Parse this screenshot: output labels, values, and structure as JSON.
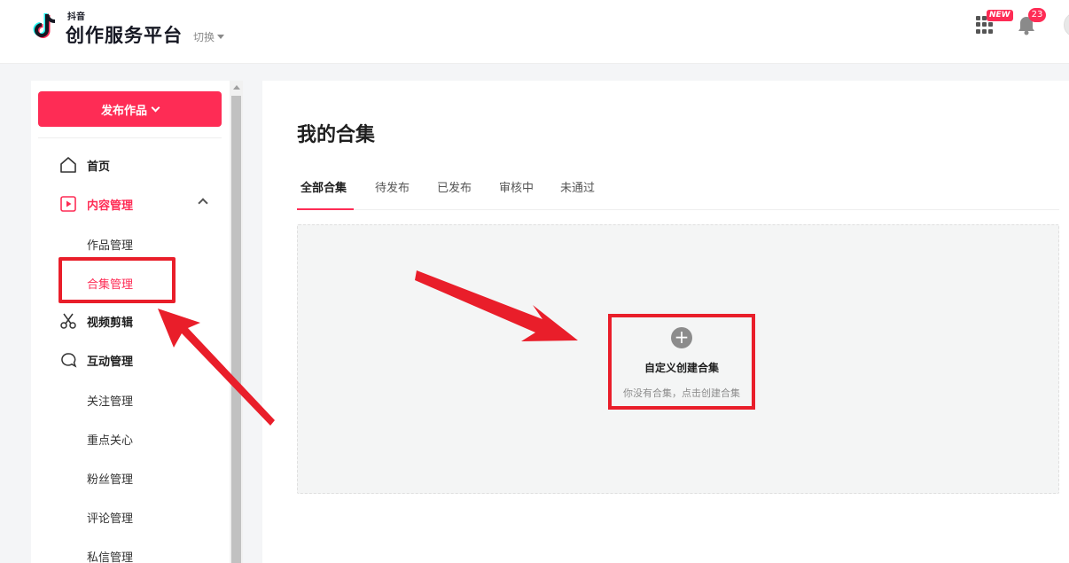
{
  "header": {
    "brand_small": "抖音",
    "brand_title": "创作服务平台",
    "switch_label": "切换",
    "new_badge": "NEW",
    "notification_count": "23"
  },
  "sidebar": {
    "publish_label": "发布作品",
    "items": [
      {
        "label": "首页",
        "icon": "home-icon"
      },
      {
        "label": "内容管理",
        "icon": "play-square-icon",
        "active": true
      },
      {
        "label": "视频剪辑",
        "icon": "scissors-icon"
      },
      {
        "label": "互动管理",
        "icon": "chat-bubble-icon"
      }
    ],
    "content_sub": [
      "作品管理",
      "合集管理"
    ],
    "interaction_sub": [
      "关注管理",
      "重点关心",
      "粉丝管理",
      "评论管理",
      "私信管理"
    ]
  },
  "main": {
    "title": "我的合集",
    "tabs": [
      "全部合集",
      "待发布",
      "已发布",
      "审核中",
      "未通过"
    ],
    "active_tab": "全部合集",
    "create": {
      "title": "自定义创建合集",
      "subtitle": "你没有合集，点击创建合集"
    }
  },
  "colors": {
    "accent": "#fe2c55",
    "annotation": "#e91e2a"
  }
}
